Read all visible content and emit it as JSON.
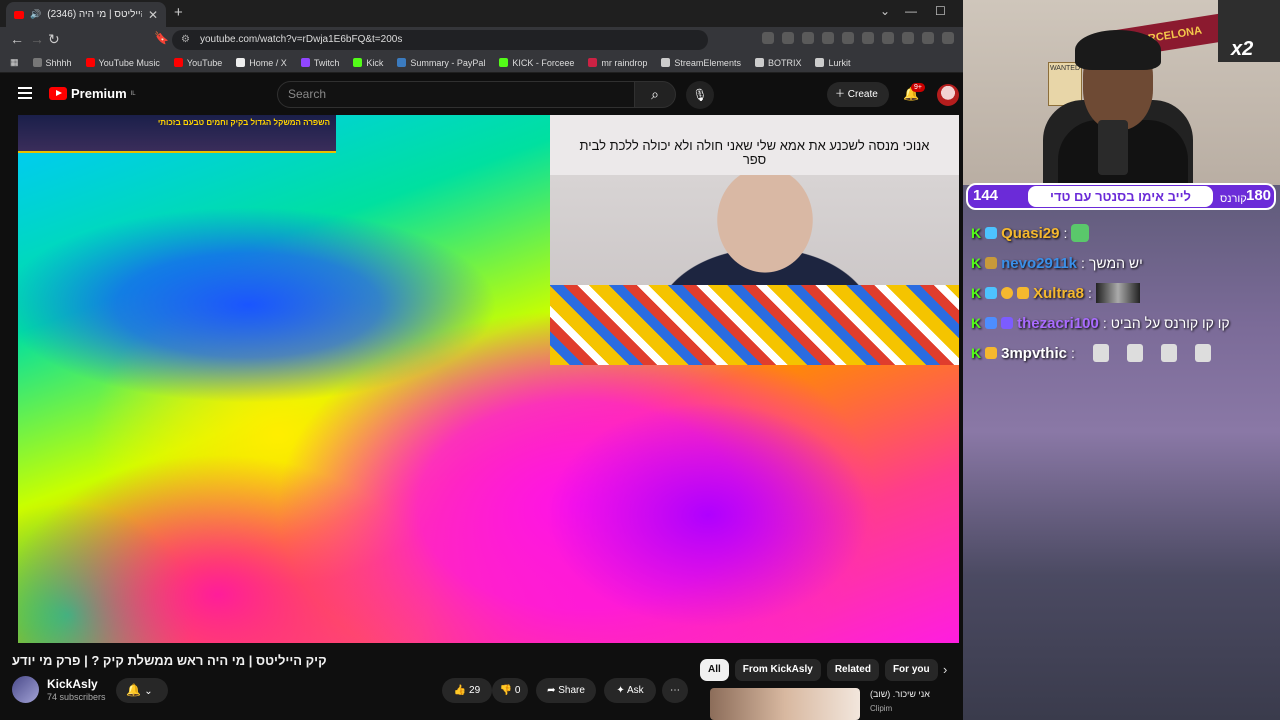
{
  "browser": {
    "tab_title": "קיק הייליטס | מי היה (2346)",
    "url": "youtube.com/watch?v=rDwja1E6bFQ&t=200s",
    "bookmarks": [
      "Shhhh",
      "YouTube Music",
      "YouTube",
      "Home / X",
      "Twitch",
      "Kick",
      "Summary - PayPal",
      "KICK - Forceee",
      "mr raindrop",
      "StreamElements",
      "BOTRIX",
      "Lurkit"
    ],
    "bookmark_colors": [
      "#777777",
      "#ff0000",
      "#ff0000",
      "#eeeeee",
      "#9146ff",
      "#53fc18",
      "#3b7bbf",
      "#53fc18",
      "#cc2244",
      "#cccccc",
      "#cccccc",
      "#cccccc"
    ]
  },
  "youtube": {
    "logo": "Premium",
    "logo_region": "IL",
    "search_placeholder": "Search",
    "create_label": "Create",
    "notif_badge": "9+",
    "video_title": "קיק הייליטס | מי היה ראש ממשלת קיק ? | פרק מי יודע",
    "channel": "KickAsly",
    "subscribers": "74 subscribers",
    "likes": "29",
    "dislikes": "0",
    "share_label": "Share",
    "ask_label": "Ask",
    "chips": [
      "All",
      "From KickAsly",
      "Related",
      "For you"
    ],
    "related_title": "אני שיכור. (שוב)",
    "related_channel": "Clipim",
    "inset_caption": "אנוכי מנסה לשכנע את אמא שלי שאני חולה ולא יכולה ללכת לבית ספר",
    "thumb_text": "השפרה המשקל הגדול בקיק וחמים טבעם בזכותי"
  },
  "stream": {
    "goal_left": "144",
    "goal_text": "לייב אימו בסנטר עם טדי",
    "goal_right": "180",
    "goal_right_label": "קורנס",
    "banner": "FC BARCELONA",
    "overlay_badge": "x2",
    "chat": [
      {
        "user": "Quasi29",
        "color": "#f5b82e",
        "message": ""
      },
      {
        "user": "nevo2911k",
        "color": "#3a8fe8",
        "message": "יש המשך"
      },
      {
        "user": "Xultra8",
        "color": "#f5b82e",
        "message": ""
      },
      {
        "user": "thezacri100",
        "color": "#a96bff",
        "message": "קו קו קורנס על הביט"
      },
      {
        "user": "3mpvthic",
        "color": "#ffffff",
        "message": ""
      }
    ]
  }
}
